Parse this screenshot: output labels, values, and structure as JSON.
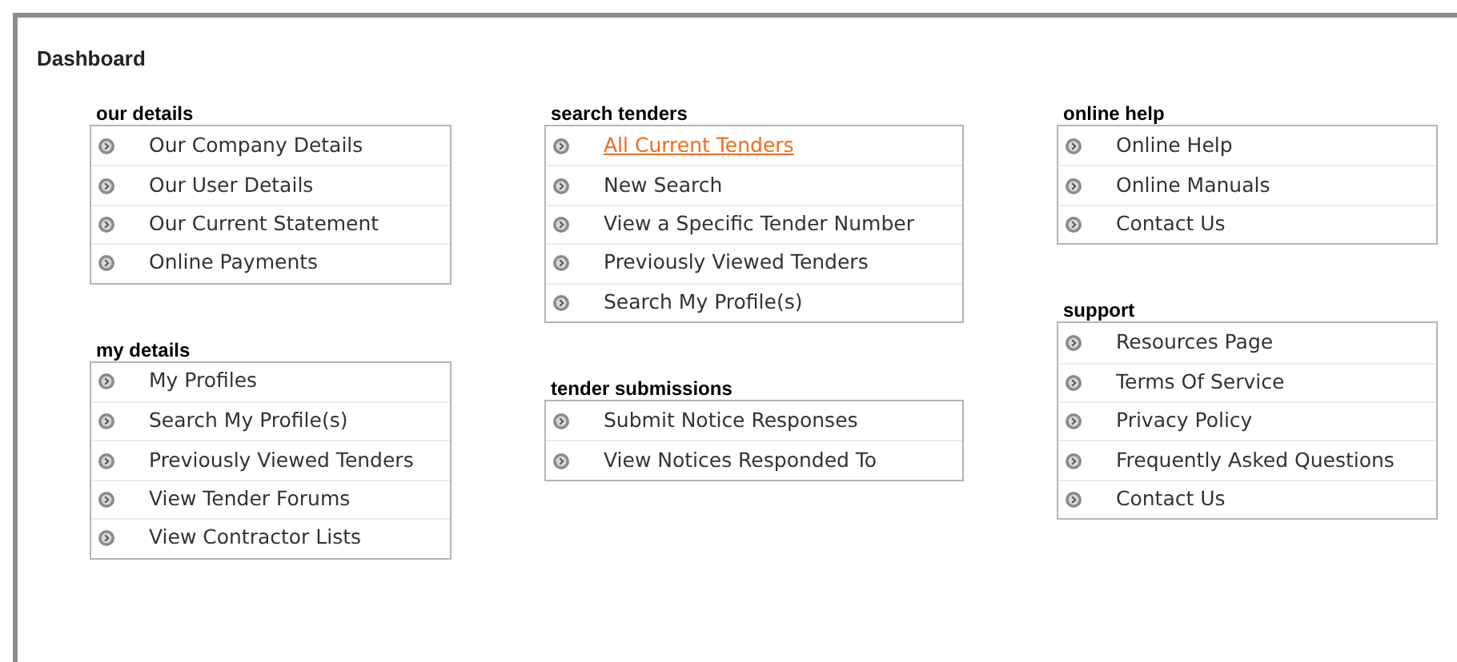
{
  "title": "Dashboard",
  "columns": [
    {
      "sections": [
        {
          "heading": "our details",
          "items": [
            {
              "label": "Our Company Details",
              "highlighted": false
            },
            {
              "label": "Our User Details",
              "highlighted": false
            },
            {
              "label": "Our Current Statement",
              "highlighted": false
            },
            {
              "label": "Online Payments",
              "highlighted": false
            }
          ]
        },
        {
          "heading": "my details",
          "items": [
            {
              "label": "My Profiles",
              "highlighted": false
            },
            {
              "label": "Search My Profile(s)",
              "highlighted": false
            },
            {
              "label": "Previously Viewed Tenders",
              "highlighted": false
            },
            {
              "label": "View Tender Forums",
              "highlighted": false
            },
            {
              "label": "View Contractor Lists",
              "highlighted": false
            }
          ]
        }
      ]
    },
    {
      "sections": [
        {
          "heading": "search tenders",
          "items": [
            {
              "label": "All Current Tenders",
              "highlighted": true
            },
            {
              "label": "New Search",
              "highlighted": false
            },
            {
              "label": "View a Specific Tender Number",
              "highlighted": false
            },
            {
              "label": "Previously Viewed Tenders",
              "highlighted": false
            },
            {
              "label": "Search My Profile(s)",
              "highlighted": false
            }
          ]
        },
        {
          "heading": "tender submissions",
          "items": [
            {
              "label": "Submit Notice Responses",
              "highlighted": false
            },
            {
              "label": "View Notices Responded To",
              "highlighted": false
            }
          ]
        }
      ]
    },
    {
      "sections": [
        {
          "heading": "online help",
          "items": [
            {
              "label": "Online Help",
              "highlighted": false
            },
            {
              "label": "Online Manuals",
              "highlighted": false
            },
            {
              "label": "Contact Us",
              "highlighted": false
            }
          ]
        },
        {
          "heading": "support",
          "items": [
            {
              "label": "Resources Page",
              "highlighted": false
            },
            {
              "label": "Terms Of Service",
              "highlighted": false
            },
            {
              "label": "Privacy Policy",
              "highlighted": false
            },
            {
              "label": "Frequently Asked Questions",
              "highlighted": false
            },
            {
              "label": "Contact Us",
              "highlighted": false
            }
          ]
        }
      ]
    }
  ]
}
